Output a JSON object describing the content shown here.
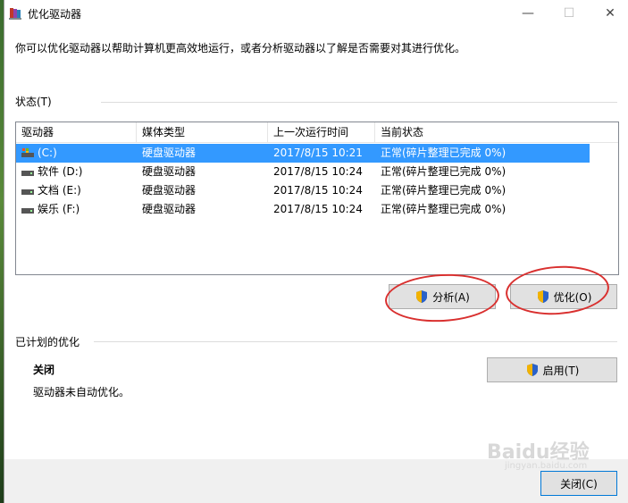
{
  "window": {
    "title": "优化驱动器",
    "min_glyph": "—",
    "max_glyph": "☐",
    "close_glyph": "✕"
  },
  "description": "你可以优化驱动器以帮助计算机更高效地运行，或者分析驱动器以了解是否需要对其进行优化。",
  "status": {
    "label": "状态(T)",
    "columns": [
      "驱动器",
      "媒体类型",
      "上一次运行时间",
      "当前状态"
    ],
    "rows": [
      {
        "drive": "(C:)",
        "media": "硬盘驱动器",
        "last_run": "2017/8/15 10:21",
        "state": "正常(碎片整理已完成 0%)",
        "selected": true,
        "icon": "windows-drive-icon"
      },
      {
        "drive": "软件 (D:)",
        "media": "硬盘驱动器",
        "last_run": "2017/8/15 10:24",
        "state": "正常(碎片整理已完成 0%)",
        "selected": false,
        "icon": "drive-icon"
      },
      {
        "drive": "文档 (E:)",
        "media": "硬盘驱动器",
        "last_run": "2017/8/15 10:24",
        "state": "正常(碎片整理已完成 0%)",
        "selected": false,
        "icon": "drive-icon"
      },
      {
        "drive": "娱乐 (F:)",
        "media": "硬盘驱动器",
        "last_run": "2017/8/15 10:24",
        "state": "正常(碎片整理已完成 0%)",
        "selected": false,
        "icon": "drive-icon"
      }
    ]
  },
  "buttons": {
    "analyze": "分析(A)",
    "optimize": "优化(O)",
    "enable": "启用(T)",
    "close": "关闭(C)"
  },
  "scheduled": {
    "label": "已计划的优化",
    "state": "关闭",
    "detail": "驱动器未自动优化。"
  },
  "watermark": {
    "main": "Baidu经验",
    "sub": "jingyan.baidu.com"
  },
  "colors": {
    "selection": "#3399ff",
    "annotation_red": "#d9302f",
    "button_face": "#e1e1e1"
  }
}
